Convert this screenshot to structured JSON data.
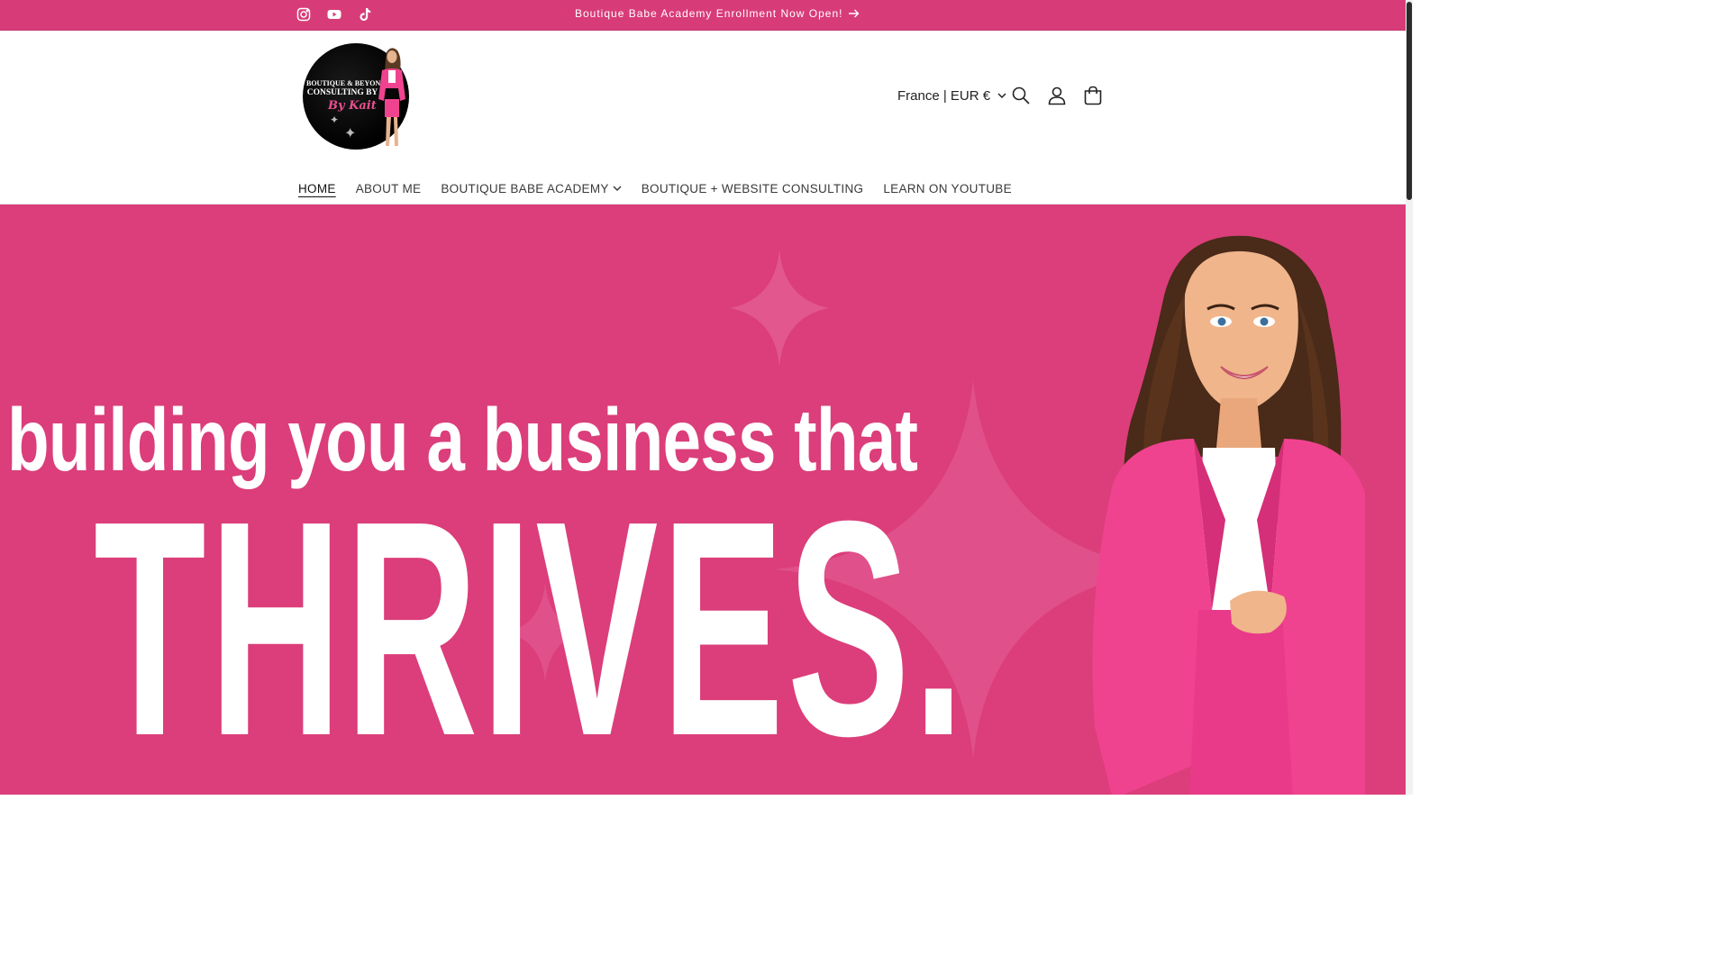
{
  "announcement": {
    "text": "Boutique Babe Academy Enrollment Now Open!",
    "arrow_icon": "arrow-right-icon"
  },
  "social": [
    {
      "name": "Instagram",
      "icon": "instagram-icon"
    },
    {
      "name": "YouTube",
      "icon": "youtube-icon"
    },
    {
      "name": "TikTok",
      "icon": "tiktok-icon"
    }
  ],
  "logo": {
    "line1": "BOUTIQUE & BEYOND",
    "line2": "CONSULTING BY",
    "line3": "By Kait"
  },
  "header": {
    "locale": "France | EUR €",
    "icons": [
      "search-icon",
      "account-icon",
      "cart-icon"
    ]
  },
  "nav": {
    "items": [
      {
        "label": "HOME",
        "active": true
      },
      {
        "label": "ABOUT ME"
      },
      {
        "label": "BOUTIQUE BABE ACADEMY",
        "dropdown": true
      },
      {
        "label": "BOUTIQUE + WEBSITE CONSULTING"
      },
      {
        "label": "LEARN ON YOUTUBE"
      }
    ]
  },
  "hero": {
    "line1": "building you a business that",
    "line2": "THRIVES."
  },
  "colors": {
    "brand_pink": "#d83c78",
    "hero_pink": "#db3e7a",
    "blazer_pink": "#f0438f"
  }
}
